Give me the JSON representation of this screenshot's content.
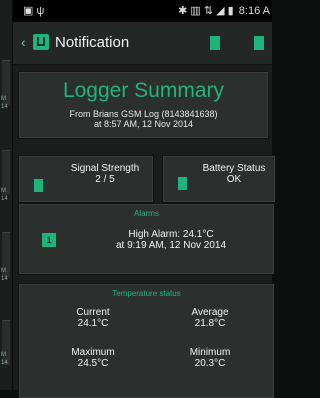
{
  "statusbar": {
    "left_icons": "▣ ψ",
    "right_icons": "✱ ▥ ⇅ ◢ ▮",
    "time": "8:16 A"
  },
  "actionbar": {
    "title": "Notification",
    "back_icon": "back-chevron-icon",
    "app_icon": "logger-app-icon"
  },
  "summary": {
    "heading": "Logger Summary",
    "line1": "From Brians GSM Log (8143841638)",
    "line2": "at 8:57 AM, 12 Nov 2014"
  },
  "signal": {
    "label": "Signal Strength",
    "value": "2 / 5"
  },
  "battery": {
    "label": "Battery Status",
    "value": "OK"
  },
  "alarms": {
    "caption": "Alarms",
    "badge": "1",
    "line1": "High Alarm: 24.1°C",
    "line2": "at 9:19 AM, 12 Nov 2014"
  },
  "temperature": {
    "caption": "Temperature status",
    "current_label": "Current",
    "current_value": "24.1°C",
    "average_label": "Average",
    "average_value": "21.8°C",
    "maximum_label": "Maximum",
    "maximum_value": "24.5°C",
    "minimum_label": "Minimum",
    "minimum_value": "20.3°C"
  },
  "left_edge": {
    "fragments": [
      "M",
      "14",
      "M",
      "14",
      "M",
      "14",
      "M",
      "14"
    ]
  },
  "colors": {
    "accent": "#1fb47c",
    "card": "#2b302e",
    "background": "#1a1d1c"
  }
}
